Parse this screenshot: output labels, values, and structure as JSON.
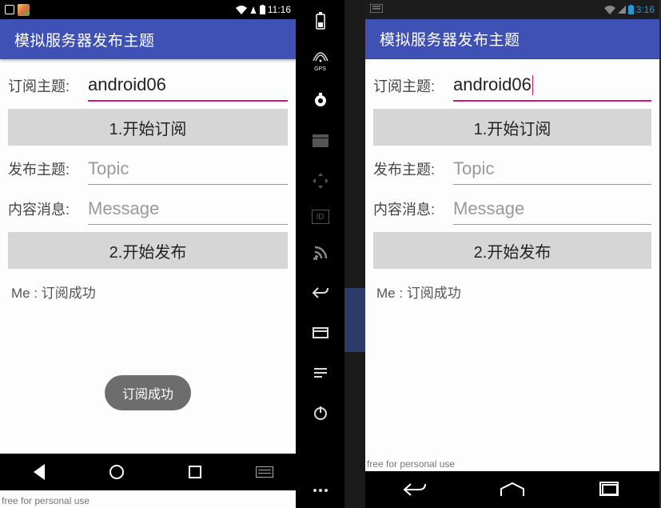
{
  "left": {
    "status": {
      "time": "11:16"
    },
    "title": "模拟服务器发布主题",
    "sub_label": "订阅主题:",
    "sub_value": "android06",
    "btn_subscribe": "1.开始订阅",
    "pub_label": "发布主题:",
    "pub_placeholder": "Topic",
    "msg_label": "内容消息:",
    "msg_placeholder": "Message",
    "btn_publish": "2.开始发布",
    "log": "Me : 订阅成功",
    "toast": "订阅成功",
    "watermark": "free for personal use"
  },
  "right": {
    "status": {
      "time": "3:16"
    },
    "title": "模拟服务器发布主题",
    "sub_label": "订阅主题:",
    "sub_value": "android06",
    "btn_subscribe": "1.开始订阅",
    "pub_label": "发布主题:",
    "pub_placeholder": "Topic",
    "msg_label": "内容消息:",
    "msg_placeholder": "Message",
    "btn_publish": "2.开始发布",
    "log": "Me : 订阅成功",
    "watermark": "free for personal use"
  },
  "sidebar": {
    "gps": "GPS"
  }
}
